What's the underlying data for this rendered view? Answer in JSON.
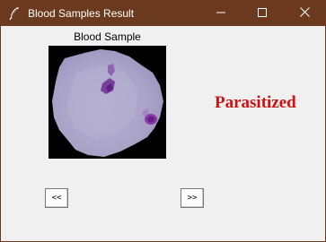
{
  "window": {
    "title": "Blood Samples Result",
    "titlebar_color": "#6b3a1e",
    "controls": {
      "minimize_icon": "minimize-icon",
      "maximize_icon": "maximize-icon",
      "close_icon": "close-icon"
    }
  },
  "sample": {
    "caption": "Blood Sample",
    "image": "blood-cell-image"
  },
  "result": {
    "label": "Parasitized",
    "color": "#d01010"
  },
  "navigation": {
    "prev_label": "<<",
    "next_label": ">>"
  }
}
